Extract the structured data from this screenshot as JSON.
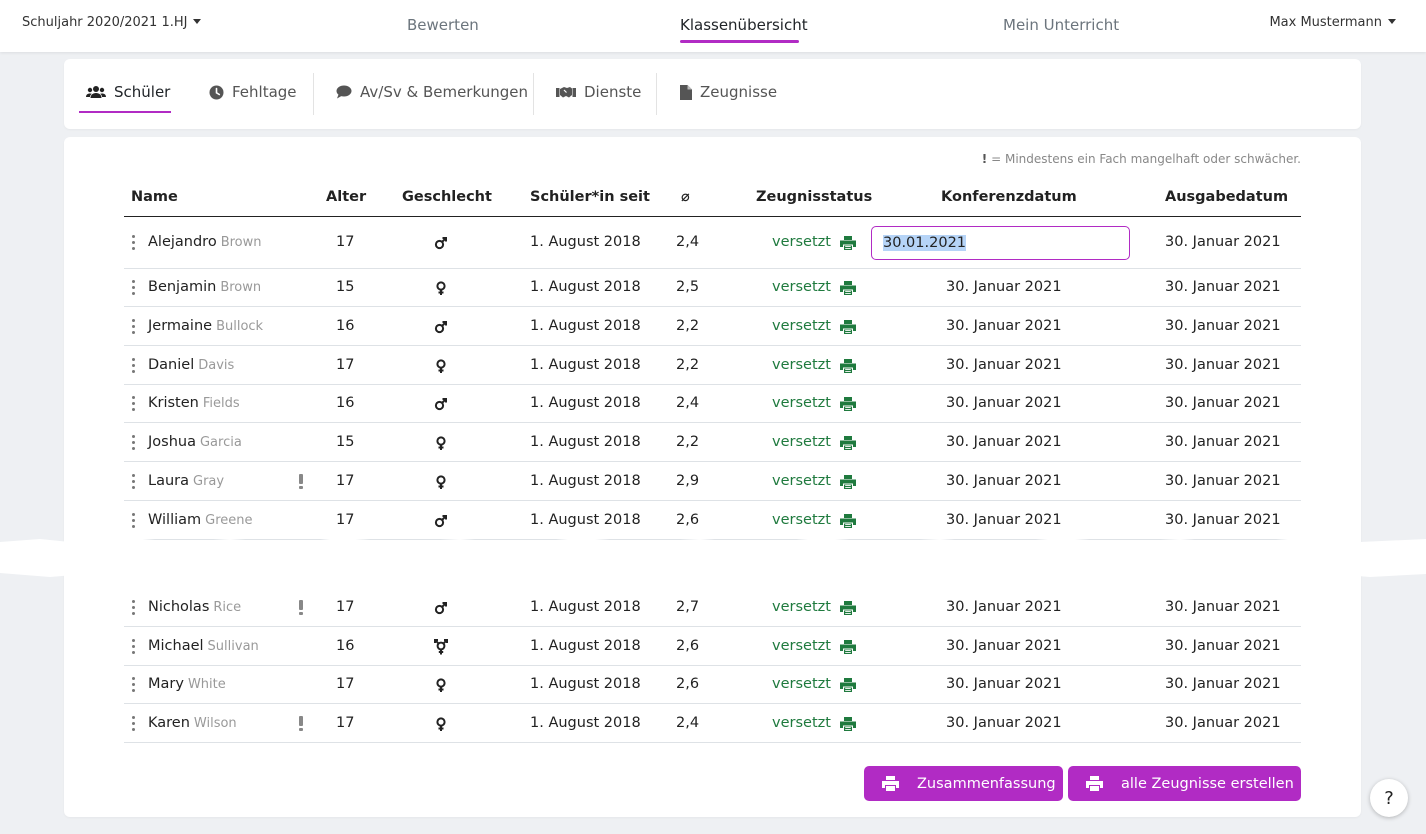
{
  "nav": {
    "year": "Schuljahr 2020/2021 1.HJ",
    "links": [
      "Bewerten",
      "Klassenübersicht",
      "Mein Unterricht"
    ],
    "user": "Max Mustermann"
  },
  "tabs": [
    "Schüler",
    "Fehltage",
    "Av/Sv & Bemerkungen",
    "Dienste",
    "Zeugnisse"
  ],
  "legend": {
    "mark": "!",
    "text": "= Mindestens ein Fach mangelhaft oder schwächer."
  },
  "table": {
    "headers": [
      "Name",
      "Alter",
      "Geschlecht",
      "Schüler*in seit",
      "⌀",
      "Zeugnisstatus",
      "Konferenzdatum",
      "Ausgabedatum"
    ],
    "editing_value": "30.01.2021",
    "rows": [
      {
        "first": "Alejandro",
        "last": "Brown",
        "age": "17",
        "gender": "male",
        "since": "1. August 2018",
        "avg": "2,4",
        "status": "versetzt",
        "conf": "30.01.2021",
        "issue": "30. Januar 2021",
        "warn": false
      },
      {
        "first": "Benjamin",
        "last": "Brown",
        "age": "15",
        "gender": "female",
        "since": "1. August 2018",
        "avg": "2,5",
        "status": "versetzt",
        "conf": "30. Januar 2021",
        "issue": "30. Januar 2021",
        "warn": false
      },
      {
        "first": "Jermaine",
        "last": "Bullock",
        "age": "16",
        "gender": "male",
        "since": "1. August 2018",
        "avg": "2,2",
        "status": "versetzt",
        "conf": "30. Januar 2021",
        "issue": "30. Januar 2021",
        "warn": false
      },
      {
        "first": "Daniel",
        "last": "Davis",
        "age": "17",
        "gender": "female",
        "since": "1. August 2018",
        "avg": "2,2",
        "status": "versetzt",
        "conf": "30. Januar 2021",
        "issue": "30. Januar 2021",
        "warn": false
      },
      {
        "first": "Kristen",
        "last": "Fields",
        "age": "16",
        "gender": "male",
        "since": "1. August 2018",
        "avg": "2,4",
        "status": "versetzt",
        "conf": "30. Januar 2021",
        "issue": "30. Januar 2021",
        "warn": false
      },
      {
        "first": "Joshua",
        "last": "Garcia",
        "age": "15",
        "gender": "female",
        "since": "1. August 2018",
        "avg": "2,2",
        "status": "versetzt",
        "conf": "30. Januar 2021",
        "issue": "30. Januar 2021",
        "warn": false
      },
      {
        "first": "Laura",
        "last": "Gray",
        "age": "17",
        "gender": "female",
        "since": "1. August 2018",
        "avg": "2,9",
        "status": "versetzt",
        "conf": "30. Januar 2021",
        "issue": "30. Januar 2021",
        "warn": true
      },
      {
        "first": "William",
        "last": "Greene",
        "age": "17",
        "gender": "male",
        "since": "1. August 2018",
        "avg": "2,6",
        "status": "versetzt",
        "conf": "30. Januar 2021",
        "issue": "30. Januar 2021",
        "warn": false
      },
      {
        "first": "Nicholas",
        "last": "Rice",
        "age": "17",
        "gender": "male",
        "since": "1. August 2018",
        "avg": "2,7",
        "status": "versetzt",
        "conf": "30. Januar 2021",
        "issue": "30. Januar 2021",
        "warn": true
      },
      {
        "first": "Michael",
        "last": "Sullivan",
        "age": "16",
        "gender": "transgender",
        "since": "1. August 2018",
        "avg": "2,6",
        "status": "versetzt",
        "conf": "30. Januar 2021",
        "issue": "30. Januar 2021",
        "warn": false
      },
      {
        "first": "Mary",
        "last": "White",
        "age": "17",
        "gender": "female",
        "since": "1. August 2018",
        "avg": "2,6",
        "status": "versetzt",
        "conf": "30. Januar 2021",
        "issue": "30. Januar 2021",
        "warn": false
      },
      {
        "first": "Karen",
        "last": "Wilson",
        "age": "17",
        "gender": "female",
        "since": "1. August 2018",
        "avg": "2,4",
        "status": "versetzt",
        "conf": "30. Januar 2021",
        "issue": "30. Januar 2021",
        "warn": true
      }
    ]
  },
  "buttons": {
    "summary": "Zusammenfassung",
    "all": "alle Zeugnisse erstellen"
  },
  "help": "?",
  "colors": {
    "accent": "#b12bc4",
    "status": "#1f7a3e"
  }
}
